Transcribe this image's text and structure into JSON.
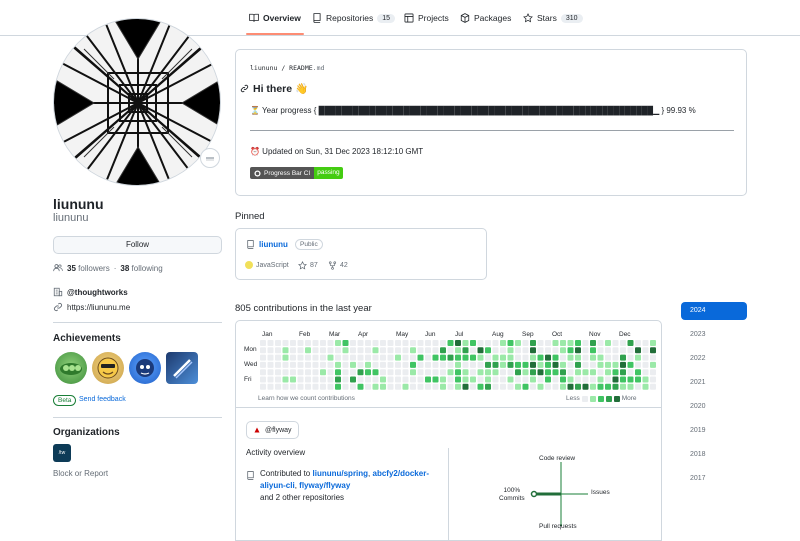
{
  "tabs": [
    {
      "label": "Overview",
      "count": null,
      "icon": "book-icon",
      "active": true
    },
    {
      "label": "Repositories",
      "count": "15",
      "icon": "repo-icon"
    },
    {
      "label": "Projects",
      "count": null,
      "icon": "table-icon"
    },
    {
      "label": "Packages",
      "count": null,
      "icon": "package-icon"
    },
    {
      "label": "Stars",
      "count": "310",
      "icon": "star-icon"
    }
  ],
  "profile": {
    "name": "liununu",
    "login": "liununu",
    "follow_label": "Follow",
    "followers_count": "35",
    "followers_label": "followers",
    "separator": "·",
    "following_count": "38",
    "following_label": "following",
    "company": "@thoughtworks",
    "website": "https://liununu.me"
  },
  "achievements": {
    "title": "Achievements",
    "beta_label": "Beta",
    "feedback_label": "Send feedback"
  },
  "organizations": {
    "title": "Organizations",
    "org_logo_text": "/tw",
    "block_label": "Block or Report"
  },
  "readme": {
    "path_user": "liununu",
    "path_sep": "/",
    "path_file": "README",
    "path_ext": ".md",
    "heading": "Hi there 👋",
    "progress_line": "⏳ Year progress { ███████████████████████████████████████████████████████████▁ } 99.93 %",
    "updated_line": "⏰ Updated on Sun, 31 Dec 2023 18:12:10 GMT",
    "badge_left": "Progress Bar CI",
    "badge_right": "passing"
  },
  "pinned": {
    "title": "Pinned",
    "repo_name": "liununu",
    "visibility": "Public",
    "language": "JavaScript",
    "stars": "87",
    "forks": "42"
  },
  "contributions": {
    "title": "805 contributions in the last year",
    "months": [
      "Jan",
      "Feb",
      "Mar",
      "Apr",
      "May",
      "Jun",
      "Jul",
      "Aug",
      "Sep",
      "Oct",
      "Nov",
      "Dec"
    ],
    "days": [
      "Mon",
      "Wed",
      "Fri"
    ],
    "learn_label": "Learn how we count contributions",
    "less_label": "Less",
    "more_label": "More",
    "colors": [
      "#ebedf0",
      "#9be9a8",
      "#40c463",
      "#30a14e",
      "#216e39"
    ]
  },
  "activity": {
    "org_chip": "@flyway",
    "title": "Activity overview",
    "contributed_prefix": "Contributed to",
    "repo1": "liununu/spring",
    "sep1": ",",
    "repo2": "abcfy2/docker-aliyun-cli",
    "sep2": ",",
    "repo3": "flyway/flyway",
    "suffix": "and 2 other repositories",
    "code_review": "Code review",
    "issues": "Issues",
    "pull_requests": "Pull requests",
    "commits_pct": "100%",
    "commits": "Commits"
  },
  "years": [
    "2024",
    "2023",
    "2022",
    "2021",
    "2020",
    "2019",
    "2018",
    "2017"
  ]
}
